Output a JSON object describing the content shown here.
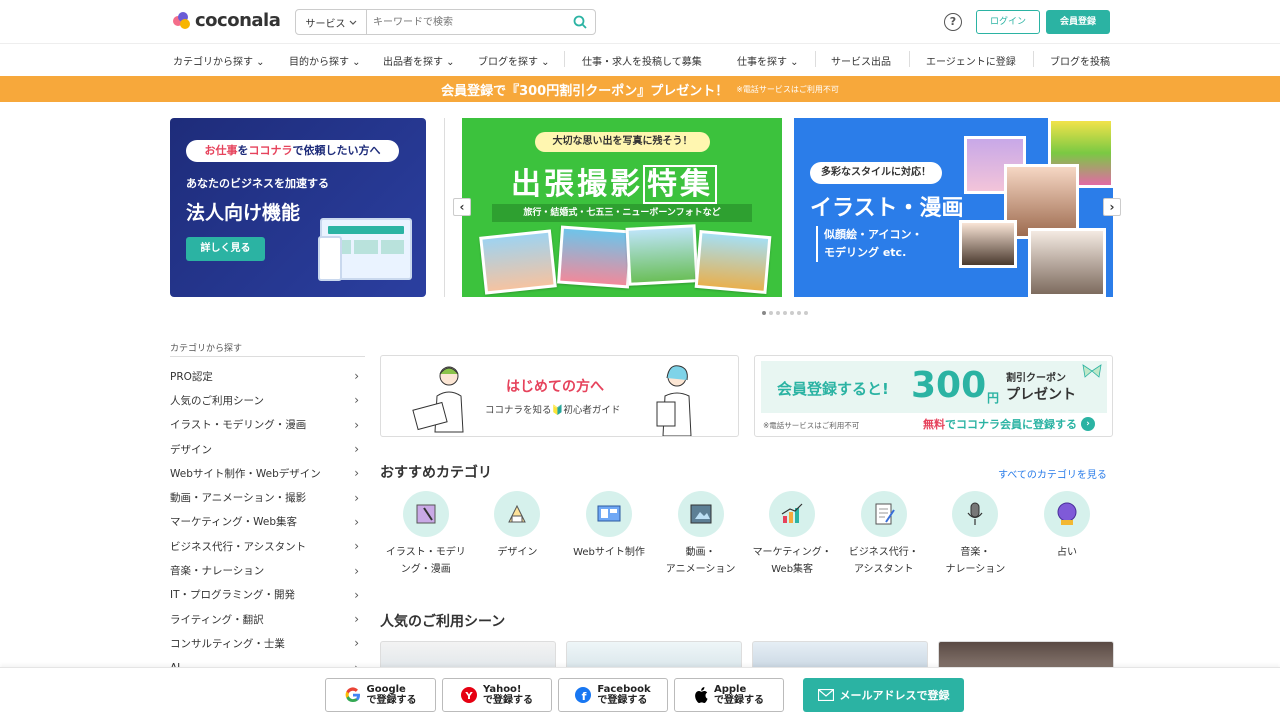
{
  "header": {
    "logo_text": "coconala",
    "search_select": "サービス",
    "search_placeholder": "キーワードで検索",
    "help_label": "?",
    "login": "ログイン",
    "register": "会員登録"
  },
  "nav": {
    "items": [
      "カテゴリから探す",
      "目的から探す",
      "出品者を探す",
      "ブログを探す",
      "仕事・求人を投稿して募集",
      "仕事を探す",
      "サービス出品",
      "エージェントに登録",
      "ブログを投稿"
    ]
  },
  "promo": {
    "main": "会員登録で『300円割引クーポン』プレゼント！",
    "note": "※電話サービスはご利用不可"
  },
  "banners": {
    "b1": {
      "pill_pre": "お仕事",
      "pill_mid": "を",
      "pill_brand": "ココナラ",
      "pill_post": "で依頼したい方へ",
      "sub": "あなたのビジネスを加速する",
      "title": "法人向け機能",
      "button": "詳しく見る"
    },
    "b2": {
      "pill": "大切な思い出を写真に残そう！",
      "title_a": "出張撮影",
      "title_b": "特集",
      "sub": "旅行・結婚式・七五三・ニューボーンフォトなど"
    },
    "b3": {
      "pill": "多彩なスタイルに対応！",
      "title": "イラスト・漫画",
      "sub1": "似顔絵・アイコン・",
      "sub2": "モデリング etc."
    },
    "prev": "‹",
    "next": "›"
  },
  "sidebar": {
    "title": "カテゴリから探す",
    "items": [
      "PRO認定",
      "人気のご利用シーン",
      "イラスト・モデリング・漫画",
      "デザイン",
      "Webサイト制作・Webデザイン",
      "動画・アニメーション・撮影",
      "マーケティング・Web集客",
      "ビジネス代行・アシスタント",
      "音楽・ナレーション",
      "IT・プログラミング・開発",
      "ライティング・翻訳",
      "コンサルティング・士業",
      "AI"
    ]
  },
  "cards": {
    "beginner": {
      "title": "はじめての方へ",
      "sub": "ココナラを知る🔰初心者ガイド"
    },
    "coupon": {
      "label": "会員登録すると!",
      "amount": "300",
      "yen": "円",
      "right1": "割引クーポン",
      "right2": "プレゼント",
      "note": "※電話サービスはご利用不可",
      "link_pre": "無料",
      "link": "でココナラ会員に登録する"
    }
  },
  "recommended": {
    "title": "おすすめカテゴリ",
    "see_all": "すべてのカテゴリを見る",
    "items": [
      {
        "label": "イラスト・モデリ\nング・漫画",
        "icon": "illustration-icon"
      },
      {
        "label": "デザイン",
        "icon": "design-icon"
      },
      {
        "label": "Webサイト制作",
        "icon": "website-icon"
      },
      {
        "label": "動画・\nアニメーション",
        "icon": "video-icon"
      },
      {
        "label": "マーケティング・\nWeb集客",
        "icon": "marketing-icon"
      },
      {
        "label": "ビジネス代行・\nアシスタント",
        "icon": "business-icon"
      },
      {
        "label": "音楽・\nナレーション",
        "icon": "music-icon"
      },
      {
        "label": "占い",
        "icon": "fortune-icon"
      }
    ]
  },
  "popular": {
    "title": "人気のご利用シーン"
  },
  "bottom": {
    "google": [
      "Google",
      "で登録する"
    ],
    "yahoo": [
      "Yahoo!",
      "で登録する"
    ],
    "facebook": [
      "Facebook",
      "で登録する"
    ],
    "apple": [
      "Apple",
      "で登録する"
    ],
    "mail": "メールアドレスで登録"
  },
  "colors": {
    "accent": "#2bb3a3",
    "promo": "#f7a83b",
    "pink": "#e6435c"
  }
}
